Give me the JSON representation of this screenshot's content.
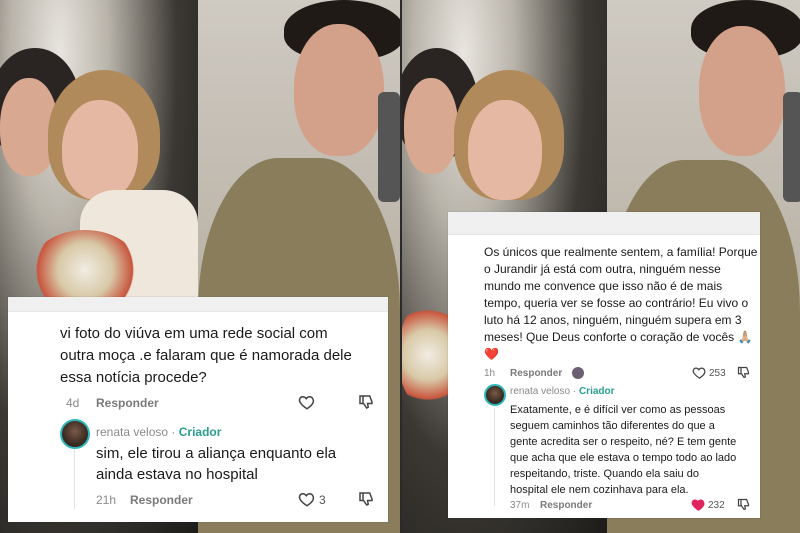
{
  "left_card": {
    "comment_lines": [
      "vi foto do viúva em uma rede social com",
      "outra moça .e falaram que é namorada dele",
      "essa notícia procede?"
    ],
    "time": "4d",
    "reply_label": "Responder",
    "reply": {
      "author": "renata veloso",
      "separator": "·",
      "creator_label": "Criador",
      "lines": [
        "sim, ele tirou a aliança enquanto ela",
        "ainda estava no hospital"
      ],
      "time": "21h",
      "reply_label": "Responder",
      "likes": "3"
    }
  },
  "right_card": {
    "comment_lines": [
      "Os únicos que realmente sentem, a família! Porque",
      "o Jurandir já está com outra, ninguém nesse",
      "mundo me convence que isso não é de mais",
      "tempo, queria ver se fosse ao contrário! Eu vivo o",
      "luto há 12 anos, ninguém, ninguém supera em 3",
      "meses! Que Deus conforte o coração de vocês 🙏🏼"
    ],
    "heart_emoji": "❤️",
    "time": "1h",
    "reply_label": "Responder",
    "likes": "253",
    "reply": {
      "author": "renata veloso",
      "separator": "·",
      "creator_label": "Criador",
      "lines": [
        "Exatamente, e é difícil ver como as pessoas",
        "seguem caminhos tão diferentes do que a",
        "gente acredita ser o respeito, né? E tem gente",
        "que acha que ele estava o tempo todo ao lado",
        "respeitando, triste. Quando ela saiu do",
        "hospital ele nem cozinhava para ela."
      ],
      "time": "37m",
      "reply_label": "Responder",
      "likes": "232"
    }
  },
  "icons": {
    "heart": "heart-outline-icon",
    "heart_filled": "heart-filled-icon",
    "dislike": "thumbs-down-icon"
  },
  "colors": {
    "creator": "#2a9d8f",
    "liked_heart": "#e0245e"
  }
}
